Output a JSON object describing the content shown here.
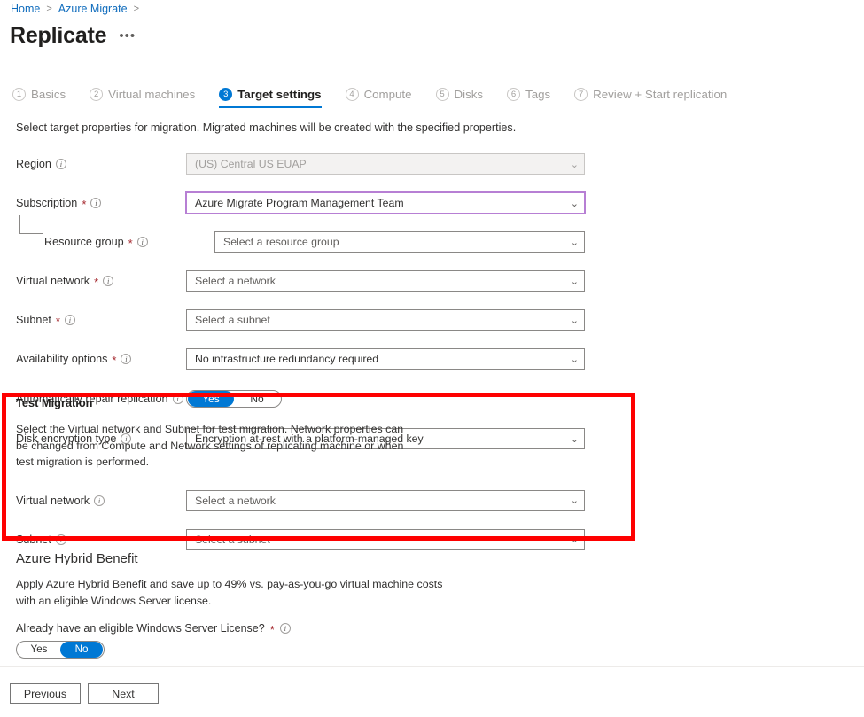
{
  "breadcrumb": {
    "items": [
      {
        "label": "Home"
      },
      {
        "label": "Azure Migrate"
      }
    ],
    "separator": ">"
  },
  "header": {
    "title": "Replicate",
    "more_label": "•••"
  },
  "steps": [
    {
      "num": "1",
      "label": "Basics",
      "active": false
    },
    {
      "num": "2",
      "label": "Virtual machines",
      "active": false
    },
    {
      "num": "3",
      "label": "Target settings",
      "active": true
    },
    {
      "num": "4",
      "label": "Compute",
      "active": false
    },
    {
      "num": "5",
      "label": "Disks",
      "active": false
    },
    {
      "num": "6",
      "label": "Tags",
      "active": false
    },
    {
      "num": "7",
      "label": "Review + Start replication",
      "active": false
    }
  ],
  "intro": "Select target properties for migration. Migrated machines will be created with the specified properties.",
  "form": {
    "region": {
      "label": "Region",
      "value": "(US) Central US EUAP",
      "required": false,
      "disabled": true
    },
    "subscription": {
      "label": "Subscription",
      "value": "Azure Migrate Program Management Team",
      "required": true,
      "focused": true
    },
    "resource_group": {
      "label": "Resource group",
      "placeholder": "Select a resource group",
      "required": true
    },
    "virtual_network": {
      "label": "Virtual network",
      "placeholder": "Select a network",
      "required": true
    },
    "subnet": {
      "label": "Subnet",
      "placeholder": "Select a subnet",
      "required": true
    },
    "availability_options": {
      "label": "Availability options",
      "value": "No infrastructure redundancy required",
      "required": true
    },
    "auto_repair": {
      "label": "Automatically repair replication",
      "yes_label": "Yes",
      "no_label": "No",
      "selected": "Yes"
    },
    "disk_encryption": {
      "label": "Disk encryption type",
      "value": "Encryption at-rest with a platform-managed key",
      "required": false
    }
  },
  "test_migration": {
    "title": "Test Migration",
    "description": "Select the Virtual network and Subnet for test migration. Network properties can be changed from Compute and Network settings of replicating machine or when test migration is performed.",
    "virtual_network": {
      "label": "Virtual network",
      "placeholder": "Select a network"
    },
    "subnet": {
      "label": "Subnet",
      "placeholder": "Select a subnet"
    },
    "highlight_color": "#fe0000"
  },
  "hybrid_benefit": {
    "title": "Azure Hybrid Benefit",
    "description": "Apply Azure Hybrid Benefit and save up to 49% vs. pay-as-you-go virtual machine costs with an eligible Windows Server license.",
    "question": "Already have an eligible Windows Server License?",
    "yes_label": "Yes",
    "no_label": "No",
    "selected": "No"
  },
  "footer": {
    "previous_label": "Previous",
    "next_label": "Next"
  },
  "chevron": "⌄",
  "accent_color": "#0078d4"
}
